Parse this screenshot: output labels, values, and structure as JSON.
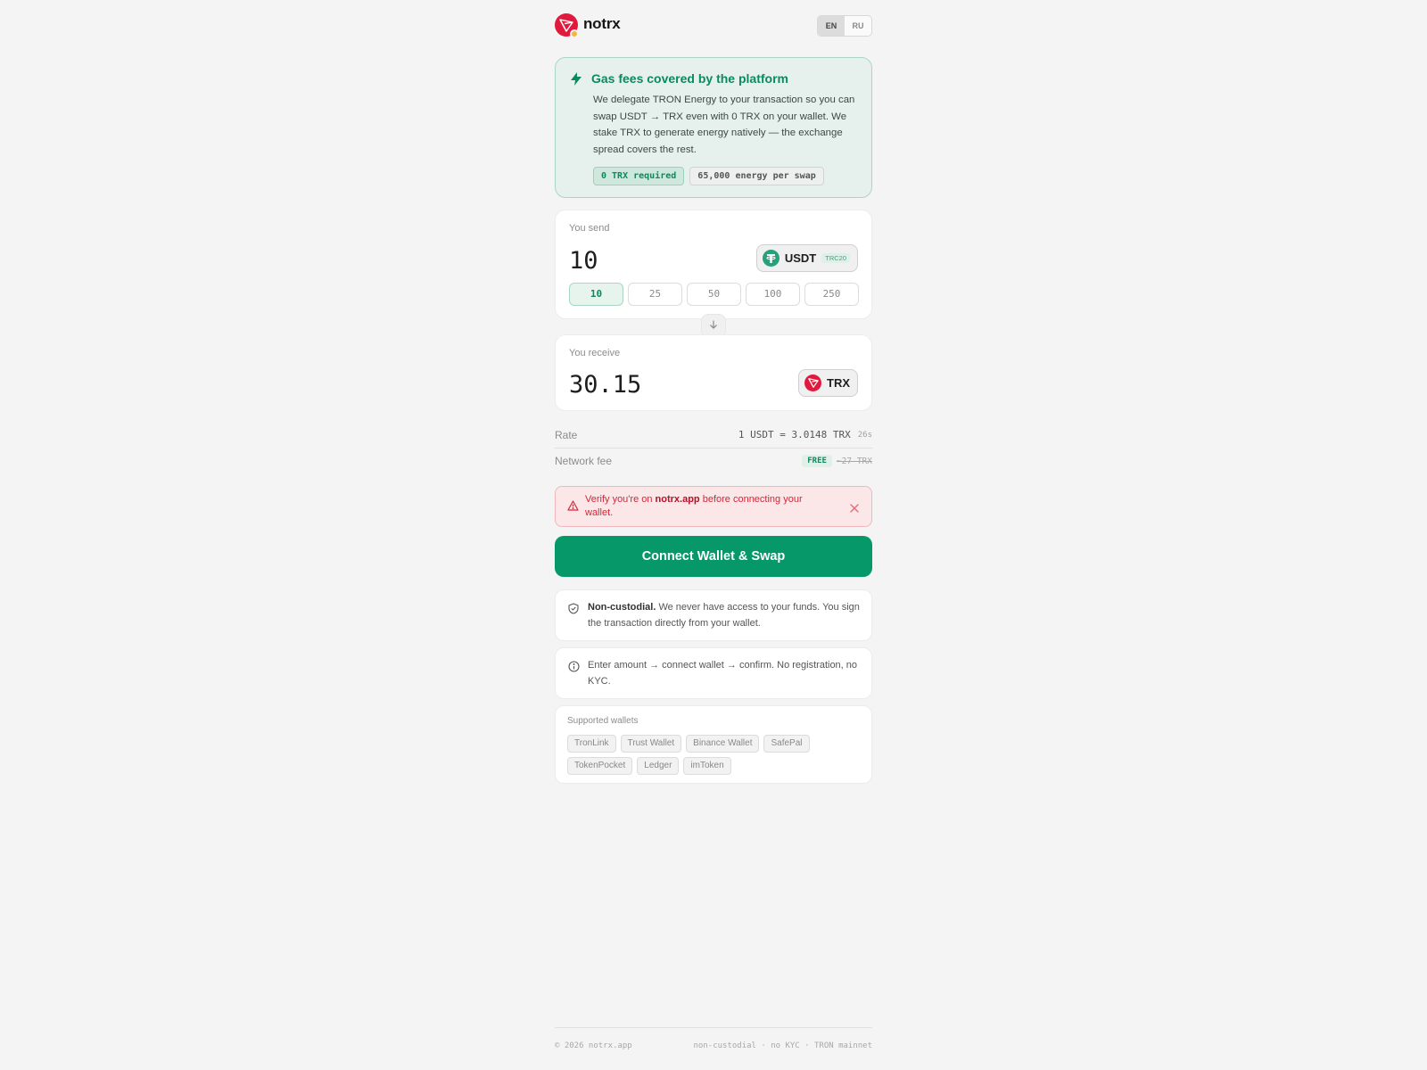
{
  "header": {
    "brand": "notrx",
    "lang_options": [
      "EN",
      "RU"
    ],
    "lang_active": "EN"
  },
  "gas_banner": {
    "title": "Gas fees covered by the platform",
    "text": "We delegate TRON Energy to your transaction so you can swap USDT → TRX even with 0 TRX on your wallet. We stake TRX to generate energy natively — the exchange spread covers the rest.",
    "chip_required": "0 TRX required",
    "chip_energy": "65,000 energy per swap"
  },
  "send": {
    "label": "You send",
    "amount": "10",
    "token": "USDT",
    "token_network": "TRC20",
    "presets": [
      "10",
      "25",
      "50",
      "100",
      "250"
    ],
    "selected_preset": "10"
  },
  "receive": {
    "label": "You receive",
    "amount": "30.15",
    "token": "TRX"
  },
  "rate": {
    "label": "Rate",
    "value": "1 USDT = 3.0148 TRX",
    "timer": "26s"
  },
  "fee": {
    "label": "Network fee",
    "badge": "FREE",
    "original": "~27 TRX"
  },
  "warning": {
    "prefix": "Verify you're on ",
    "domain": "notrx.app",
    "suffix": " before connecting your wallet."
  },
  "cta": {
    "label": "Connect Wallet & Swap"
  },
  "notes": {
    "custody_bold": "Non-custodial.",
    "custody_text": " We never have access to your funds. You sign the transaction directly from your wallet.",
    "steps_text": "Enter amount → connect wallet → confirm. No registration, no KYC."
  },
  "wallets": {
    "title": "Supported wallets",
    "items": [
      "TronLink",
      "Trust Wallet",
      "Binance Wallet",
      "SafePal",
      "TokenPocket",
      "Ledger",
      "imToken"
    ]
  },
  "footer": {
    "left": "© 2026 notrx.app",
    "right": "non-custodial · no KYC · TRON mainnet"
  },
  "colors": {
    "accent": "#079869",
    "tron_red": "#e0193d",
    "tether_green": "#26a17b",
    "warning": "#cf2a3a"
  },
  "icons": {
    "brand": "tron-logo-icon",
    "gas": "lightning-bolt-icon",
    "swap": "arrow-down-icon",
    "warning": "warning-triangle-icon",
    "close": "close-icon",
    "custody": "shield-check-icon",
    "info": "info-circle-icon"
  }
}
